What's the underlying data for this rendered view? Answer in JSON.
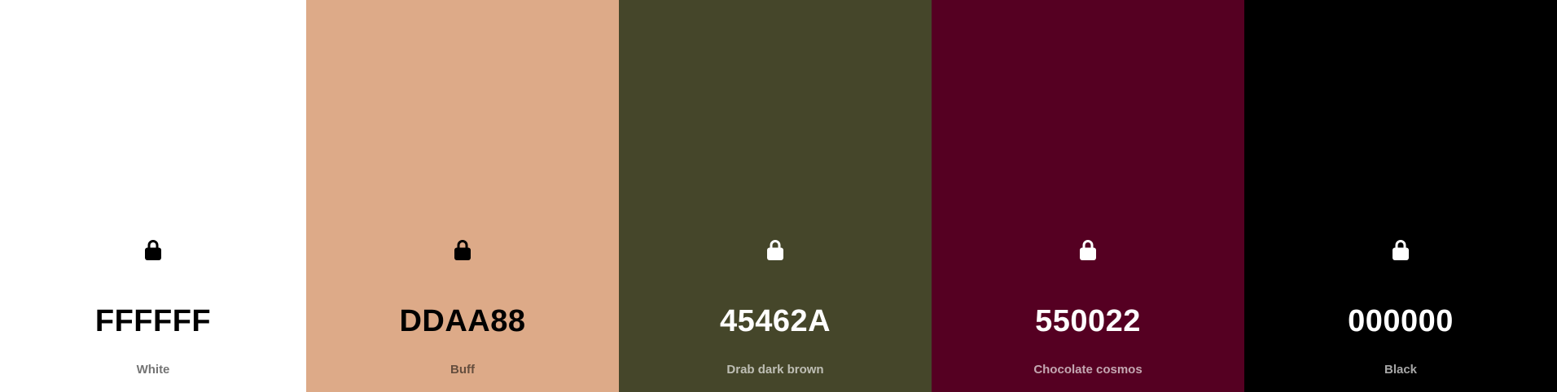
{
  "palette": {
    "colors": [
      {
        "hex": "FFFFFF",
        "name": "White",
        "color": "#FFFFFF",
        "text_theme": "light",
        "lock_icon": "lock-icon"
      },
      {
        "hex": "DDAA88",
        "name": "Buff",
        "color": "#DDAA88",
        "text_theme": "light",
        "lock_icon": "lock-icon"
      },
      {
        "hex": "45462A",
        "name": "Drab dark brown",
        "color": "#45462A",
        "text_theme": "dark",
        "lock_icon": "lock-icon"
      },
      {
        "hex": "550022",
        "name": "Chocolate cosmos",
        "color": "#550022",
        "text_theme": "dark",
        "lock_icon": "lock-icon"
      },
      {
        "hex": "000000",
        "name": "Black",
        "color": "#000000",
        "text_theme": "dark",
        "lock_icon": "lock-icon"
      }
    ]
  }
}
